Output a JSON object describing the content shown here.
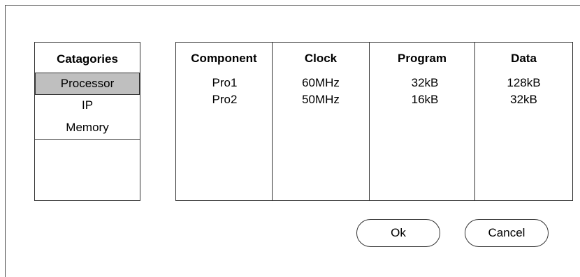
{
  "categories": {
    "header": "Catagories",
    "items": [
      {
        "label": "Processor",
        "selected": true
      },
      {
        "label": "IP",
        "selected": false
      },
      {
        "label": "Memory",
        "selected": false
      }
    ]
  },
  "table": {
    "columns": [
      "Component",
      "Clock",
      "Program",
      "Data"
    ],
    "rows": [
      [
        "Pro1",
        "60MHz",
        "32kB",
        "128kB"
      ],
      [
        "Pro2",
        "50MHz",
        "16kB",
        "32kB"
      ]
    ]
  },
  "buttons": {
    "ok_label": "Ok",
    "cancel_label": "Cancel"
  },
  "colors": {
    "selected_background": "#bfbfbf",
    "border": "#333333"
  }
}
